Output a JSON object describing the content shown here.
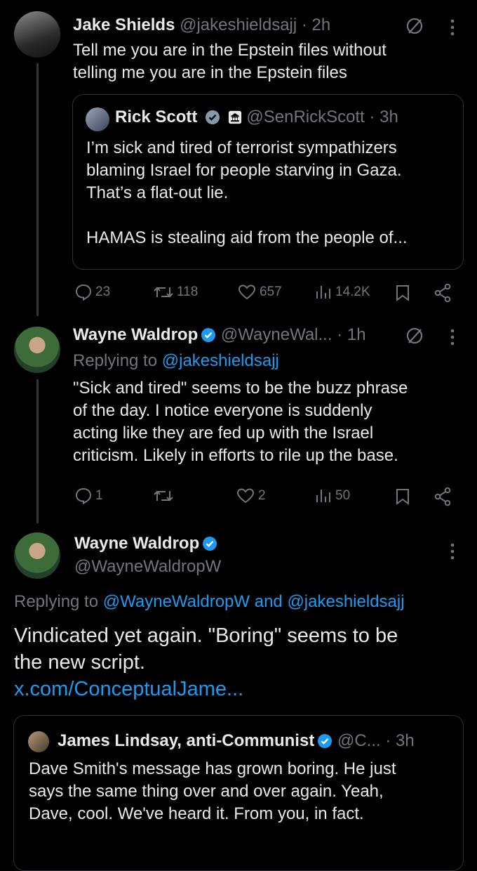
{
  "tweet1": {
    "name": "Jake Shields",
    "handle": "@jakeshieldsajj",
    "time": "· 2h",
    "text_line1": "Tell me you are in the Epstein files without",
    "text_line2": "telling me you are in the Epstein files",
    "quote": {
      "name": "Rick Scott",
      "handle": "@SenRickScott",
      "time": "· 3h",
      "line1": "I’m sick and tired of terrorist sympathizers",
      "line2": "blaming Israel for people starving in Gaza.",
      "line3": "That’s a flat-out lie.",
      "line4": "HAMAS is stealing aid from the people of..."
    },
    "replies": "23",
    "reposts": "118",
    "likes": "657",
    "views": "14.2K"
  },
  "tweet2": {
    "name": "Wayne Waldrop",
    "handle": "@WayneWal...",
    "time": "· 1h",
    "replying_prefix": "Replying to",
    "replying_to": "@jakeshieldsajj",
    "line1": "\"Sick and tired\" seems to be the buzz phrase",
    "line2": "of the day. I notice everyone is suddenly",
    "line3": "acting like they are fed up with the Israel",
    "line4": "criticism. Likely in efforts to rile up the base.",
    "replies": "1",
    "likes": "2",
    "views": "50"
  },
  "tweet3": {
    "name": "Wayne Waldrop",
    "handle": "@WayneWaldropW",
    "replying_prefix": "Replying to",
    "replying_to1": "@WayneWaldropW",
    "and": "and",
    "replying_to2": "@jakeshieldsajj",
    "line1": "Vindicated yet again. \"Boring\" seems to be",
    "line2": "the new script.",
    "link": "x.com/ConceptualJame...",
    "quote": {
      "name": "James Lindsay, anti-Communist",
      "handle": "@C...",
      "time": "· 3h",
      "line1": "Dave Smith's message has grown boring. He just",
      "line2": "says the same thing over and over again. Yeah,",
      "line3": "Dave, cool. We've heard it. From you, in fact."
    }
  },
  "colors": {
    "background": "#000000",
    "text": "#e7e9ea",
    "muted": "#71767b",
    "link": "#1d9bf0",
    "border": "#2f3336"
  }
}
